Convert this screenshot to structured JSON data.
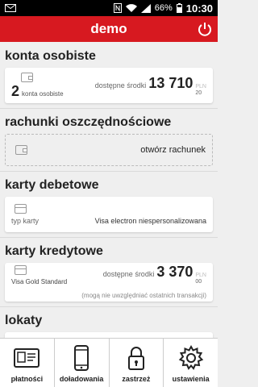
{
  "status": {
    "battery": "66%",
    "time": "10:30"
  },
  "appbar": {
    "title": "demo"
  },
  "sections": {
    "konta": {
      "title": "konta osobiste",
      "count": "2",
      "count_label": "konta osobiste",
      "balance_label": "dostępne środki",
      "amount": "13 710",
      "cents_top": "PLN",
      "cents": "20"
    },
    "rachunki": {
      "title": "rachunki oszczędnościowe",
      "action": "otwórz rachunek"
    },
    "debetowe": {
      "title": "karty debetowe",
      "type_label": "typ karty",
      "type_value": "Visa electron niespersonalizowana"
    },
    "kredytowe": {
      "title": "karty kredytowe",
      "card_name": "Visa Gold Standard",
      "balance_label": "dostępne środki",
      "amount": "3 370",
      "cents_top": "PLN",
      "cents": "00",
      "note": "(mogą nie uwzględniać ostatnich transakcji)"
    },
    "lokaty": {
      "title": "lokaty"
    }
  },
  "nav": {
    "platnosci": "płatności",
    "doladowania": "doładowania",
    "zastrzez": "zastrzeż",
    "ustawienia": "ustawienia"
  }
}
